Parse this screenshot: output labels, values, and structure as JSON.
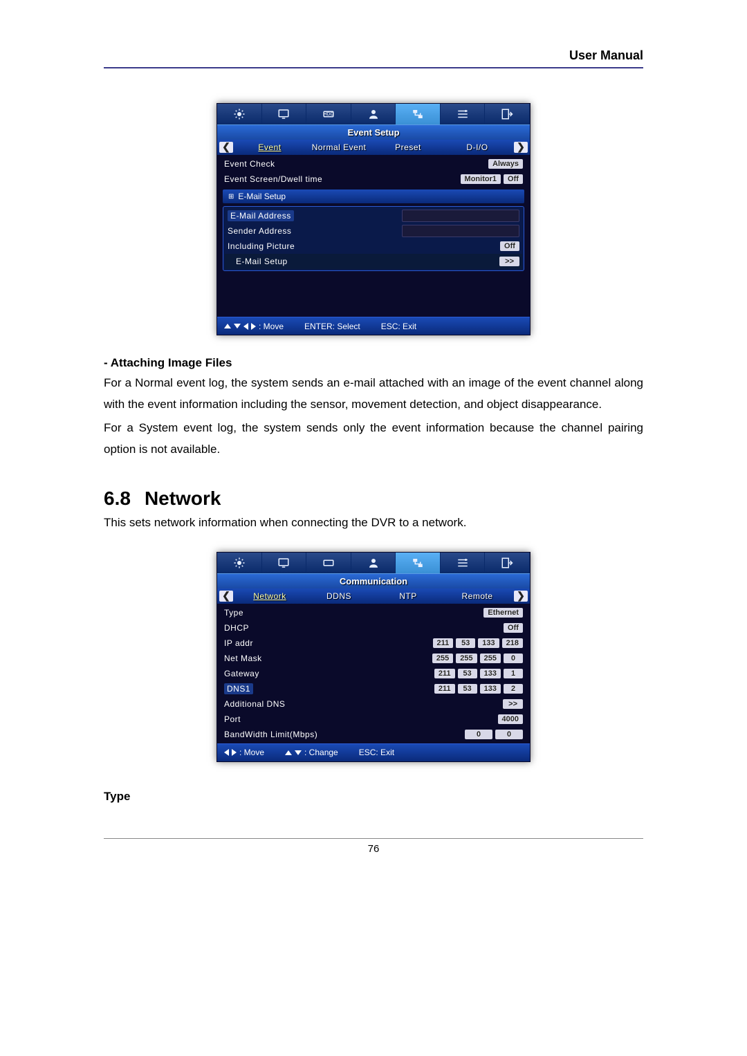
{
  "doc": {
    "header": "User Manual",
    "page_number": "76",
    "section1": {
      "heading": "- Attaching Image Files",
      "p1": "For a Normal event log, the system sends an e-mail attached with an image of the event channel along with the event information including the sensor, movement detection, and object disappearance.",
      "p2": "For a System event log, the system sends only the event information because the channel pairing option is not available."
    },
    "section2": {
      "number": "6.8",
      "title": "Network",
      "intro": "This sets network information when connecting the DVR to a network.",
      "sub": "Type"
    }
  },
  "event_window": {
    "title": "Event Setup",
    "tabs": [
      "Event",
      "Normal Event",
      "Preset",
      "D-I/O"
    ],
    "rows": {
      "event_check_label": "Event Check",
      "event_check_value": "Always",
      "event_screen_label": "Event Screen/Dwell time",
      "event_screen_monitor": "Monitor1",
      "event_screen_value": "Off"
    },
    "email_section": "E-Mail Setup",
    "email": {
      "addr_label": "E-Mail Address",
      "sender_label": "Sender Address",
      "pic_label": "Including Picture",
      "pic_value": "Off",
      "setup_label": "E-Mail Setup",
      "setup_value": ">>"
    },
    "footer": {
      "move": ": Move",
      "enter": "ENTER: Select",
      "esc": "ESC: Exit"
    }
  },
  "network_window": {
    "title": "Communication",
    "tabs": [
      "Network",
      "DDNS",
      "NTP",
      "Remote"
    ],
    "rows": {
      "type_label": "Type",
      "type_value": "Ethernet",
      "dhcp_label": "DHCP",
      "dhcp_value": "Off",
      "ip_label": "IP addr",
      "ip": [
        "211",
        "53",
        "133",
        "218"
      ],
      "mask_label": "Net Mask",
      "mask": [
        "255",
        "255",
        "255",
        "0"
      ],
      "gw_label": "Gateway",
      "gw": [
        "211",
        "53",
        "133",
        "1"
      ],
      "dns_label": "DNS1",
      "dns": [
        "211",
        "53",
        "133",
        "2"
      ],
      "adns_label": "Additional DNS",
      "adns_value": ">>",
      "port_label": "Port",
      "port_value": "4000",
      "bw_label": "BandWidth Limit(Mbps)",
      "bw": [
        "0",
        "0"
      ]
    },
    "footer": {
      "move": ": Move",
      "change": ": Change",
      "esc": "ESC: Exit"
    }
  }
}
